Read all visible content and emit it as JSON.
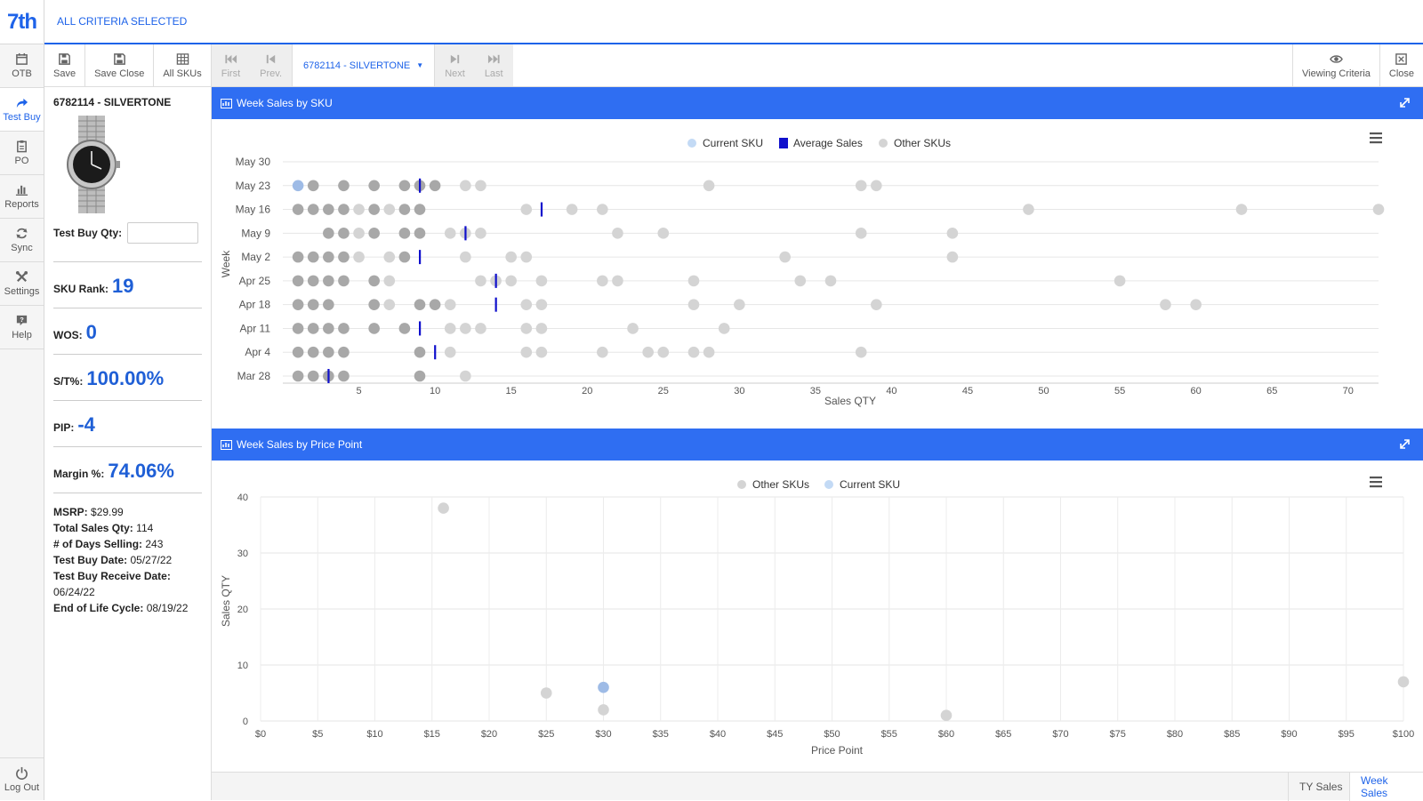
{
  "app": {
    "logo": "7th",
    "criteria": "ALL CRITERIA SELECTED"
  },
  "nav": {
    "items": [
      {
        "label": "OTB",
        "icon": "calendar-icon"
      },
      {
        "label": "Test Buy",
        "icon": "share-arrow-icon"
      },
      {
        "label": "PO",
        "icon": "clipboard-icon"
      },
      {
        "label": "Reports",
        "icon": "bar-chart-icon"
      },
      {
        "label": "Sync",
        "icon": "refresh-icon"
      },
      {
        "label": "Settings",
        "icon": "tools-icon"
      },
      {
        "label": "Help",
        "icon": "help-icon"
      }
    ],
    "logout": "Log Out"
  },
  "toolbar": {
    "save": "Save",
    "save_close": "Save Close",
    "all_skus": "All SKUs",
    "first": "First",
    "prev": "Prev.",
    "sku": "6782114 - SILVERTONE",
    "next": "Next",
    "last": "Last",
    "viewing_criteria": "Viewing Criteria",
    "close": "Close"
  },
  "info": {
    "title": "6782114 - SILVERTONE",
    "test_buy_qty_label": "Test Buy Qty:",
    "test_buy_qty_value": "",
    "metrics": [
      {
        "label": "SKU Rank:",
        "value": "19"
      },
      {
        "label": "WOS:",
        "value": "0"
      },
      {
        "label": "S/T%:",
        "value": "100.00%"
      },
      {
        "label": "PIP:",
        "value": "-4"
      },
      {
        "label": "Margin %:",
        "value": "74.06%"
      }
    ],
    "details": [
      {
        "label": "MSRP:",
        "value": "$29.99"
      },
      {
        "label": "Total Sales Qty:",
        "value": "114"
      },
      {
        "label": "# of Days Selling:",
        "value": "243"
      },
      {
        "label": "Test Buy Date:",
        "value": "05/27/22"
      },
      {
        "label": "Test Buy Receive Date:",
        "value": "06/24/22"
      },
      {
        "label": "End of Life Cycle:",
        "value": "08/19/22"
      }
    ]
  },
  "colors": {
    "accent": "#2f6ef2",
    "current_sku": "#a9c6ec",
    "avg_sales": "#1010cc",
    "other_dark": "#9a9a9a",
    "other_light": "#cfcfcf"
  },
  "chart_data": [
    {
      "type": "scatter",
      "title": "Week Sales by SKU",
      "xlabel": "Sales QTY",
      "ylabel": "Week",
      "xlim": [
        0,
        72
      ],
      "x_ticks": [
        5,
        10,
        15,
        20,
        25,
        30,
        35,
        40,
        45,
        50,
        55,
        60,
        65,
        70
      ],
      "categories": [
        "May 30",
        "May 23",
        "May 16",
        "May 9",
        "May 2",
        "Apr 25",
        "Apr 18",
        "Apr 11",
        "Apr 4",
        "Mar 28"
      ],
      "legend": [
        "Current SKU",
        "Average Sales",
        "Other SKUs"
      ],
      "legend_position": "top",
      "current_sku": [
        {
          "week": "May 23",
          "x": 1
        }
      ],
      "average_sales": [
        {
          "week": "May 23",
          "x": 9
        },
        {
          "week": "May 16",
          "x": 17
        },
        {
          "week": "May 9",
          "x": 12
        },
        {
          "week": "May 2",
          "x": 9
        },
        {
          "week": "Apr 25",
          "x": 14
        },
        {
          "week": "Apr 18",
          "x": 14
        },
        {
          "week": "Apr 11",
          "x": 9
        },
        {
          "week": "Apr 4",
          "x": 10
        },
        {
          "week": "Mar 28",
          "x": 3
        }
      ],
      "other_skus": [
        {
          "week": "May 23",
          "x": [
            2,
            4,
            6,
            8,
            9,
            10,
            12,
            13,
            28,
            38,
            39
          ]
        },
        {
          "week": "May 16",
          "x": [
            1,
            2,
            3,
            4,
            5,
            6,
            7,
            8,
            9,
            16,
            19,
            21,
            49,
            63,
            72
          ]
        },
        {
          "week": "May 9",
          "x": [
            3,
            4,
            5,
            6,
            8,
            9,
            11,
            12,
            13,
            22,
            25,
            38,
            44
          ]
        },
        {
          "week": "May 2",
          "x": [
            1,
            2,
            3,
            4,
            5,
            7,
            8,
            12,
            15,
            16,
            33,
            44
          ]
        },
        {
          "week": "Apr 25",
          "x": [
            1,
            2,
            3,
            4,
            6,
            7,
            13,
            14,
            15,
            17,
            21,
            22,
            27,
            34,
            36,
            55
          ]
        },
        {
          "week": "Apr 18",
          "x": [
            1,
            2,
            3,
            6,
            7,
            9,
            10,
            11,
            16,
            17,
            27,
            30,
            39,
            58,
            60
          ]
        },
        {
          "week": "Apr 11",
          "x": [
            1,
            2,
            3,
            4,
            6,
            8,
            11,
            12,
            13,
            16,
            17,
            23,
            29
          ]
        },
        {
          "week": "Apr 4",
          "x": [
            1,
            2,
            3,
            4,
            9,
            11,
            16,
            17,
            21,
            24,
            25,
            27,
            28,
            38
          ]
        },
        {
          "week": "Mar 28",
          "x": [
            1,
            2,
            3,
            4,
            9,
            12
          ]
        }
      ]
    },
    {
      "type": "scatter",
      "title": "Week Sales by Price Point",
      "xlabel": "Price Point",
      "ylabel": "Sales QTY",
      "xlim": [
        0,
        100
      ],
      "ylim": [
        0,
        40
      ],
      "x_ticks": [
        "$0",
        "$5",
        "$10",
        "$15",
        "$20",
        "$25",
        "$30",
        "$35",
        "$40",
        "$45",
        "$50",
        "$55",
        "$60",
        "$65",
        "$70",
        "$75",
        "$80",
        "$85",
        "$90",
        "$95",
        "$100"
      ],
      "y_ticks": [
        0,
        10,
        20,
        30,
        40
      ],
      "legend": [
        "Other SKUs",
        "Current SKU"
      ],
      "legend_position": "top",
      "other_skus": [
        {
          "x": 16,
          "y": 38
        },
        {
          "x": 25,
          "y": 5
        },
        {
          "x": 30,
          "y": 2
        },
        {
          "x": 60,
          "y": 1
        },
        {
          "x": 100,
          "y": 7
        }
      ],
      "current_sku": [
        {
          "x": 30,
          "y": 6
        }
      ]
    }
  ],
  "footer": {
    "tabs": [
      {
        "label": "TY Sales"
      },
      {
        "label": "Week Sales"
      }
    ]
  }
}
